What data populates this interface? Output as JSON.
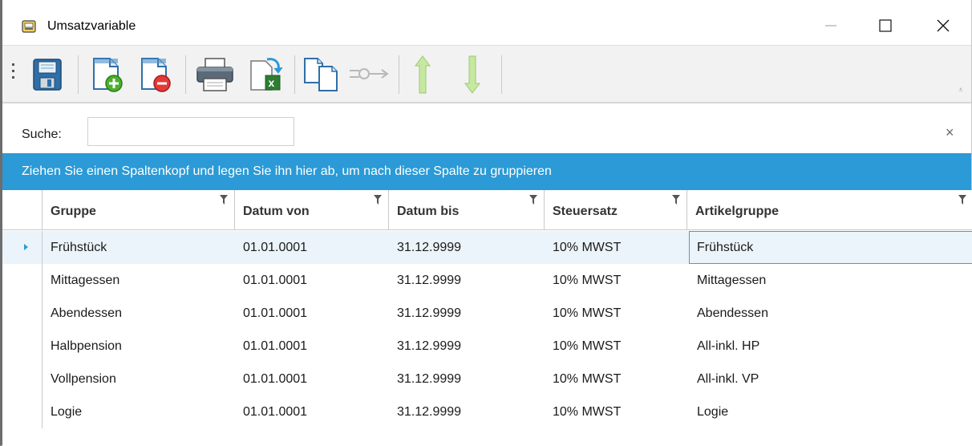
{
  "window": {
    "title": "Umsatzvariable",
    "app_icon": "app-window-icon"
  },
  "toolbar": {
    "buttons": [
      {
        "name": "save",
        "icon": "floppy-disk-icon",
        "enabled": true
      },
      {
        "name": "add",
        "icon": "document-add-icon",
        "enabled": true
      },
      {
        "name": "delete",
        "icon": "document-remove-icon",
        "enabled": true
      },
      {
        "name": "print",
        "icon": "printer-icon",
        "enabled": true
      },
      {
        "name": "export-excel",
        "icon": "excel-export-icon",
        "enabled": true
      },
      {
        "name": "copy",
        "icon": "copy-documents-icon",
        "enabled": true
      },
      {
        "name": "connect",
        "icon": "connect-arrow-icon",
        "enabled": false
      },
      {
        "name": "move-up",
        "icon": "arrow-up-icon",
        "enabled": false
      },
      {
        "name": "move-down",
        "icon": "arrow-down-icon",
        "enabled": false
      }
    ],
    "overflow_glyph": "⩡"
  },
  "search": {
    "label": "Suche:",
    "value": "",
    "placeholder": "",
    "clear_glyph": "×"
  },
  "group_panel": {
    "text": "Ziehen Sie einen Spaltenkopf und legen Sie ihn hier ab, um nach dieser Spalte zu gruppieren"
  },
  "grid": {
    "columns": [
      "Gruppe",
      "Datum von",
      "Datum bis",
      "Steuersatz",
      "Artikelgruppe"
    ],
    "rows": [
      [
        "Frühstück",
        "01.01.0001",
        "31.12.9999",
        "10% MWST",
        "Frühstück"
      ],
      [
        "Mittagessen",
        "01.01.0001",
        "31.12.9999",
        "10% MWST",
        "Mittagessen"
      ],
      [
        "Abendessen",
        "01.01.0001",
        "31.12.9999",
        "10% MWST",
        "Abendessen"
      ],
      [
        "Halbpension",
        "01.01.0001",
        "31.12.9999",
        "10% MWST",
        "All-inkl. HP"
      ],
      [
        "Vollpension",
        "01.01.0001",
        "31.12.9999",
        "10% MWST",
        "All-inkl. VP"
      ],
      [
        "Logie",
        "01.01.0001",
        "31.12.9999",
        "10% MWST",
        "Logie"
      ]
    ],
    "selected_row": 0,
    "accent": "#2b9ad6"
  }
}
